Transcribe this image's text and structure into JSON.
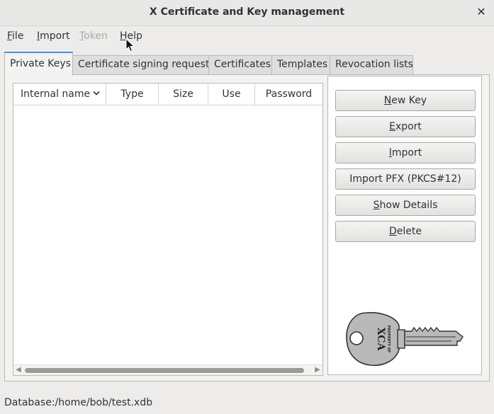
{
  "window": {
    "title": "X Certificate and Key management",
    "close_glyph": "✕"
  },
  "menu": {
    "file": {
      "ul": "F",
      "rest": "ile"
    },
    "import": {
      "ul": "I",
      "rest": "mport"
    },
    "token": {
      "ul": "T",
      "rest": "oken"
    },
    "help": {
      "ul": "H",
      "rest": "elp"
    }
  },
  "tabs": [
    {
      "label": "Private Keys",
      "active": true
    },
    {
      "label": "Certificate signing requests"
    },
    {
      "label": "Certificates"
    },
    {
      "label": "Templates"
    },
    {
      "label": "Revocation lists"
    }
  ],
  "columns": [
    "Internal name",
    "Type",
    "Size",
    "Use",
    "Password"
  ],
  "buttons": {
    "new_key": {
      "ul": "N",
      "rest": "ew Key"
    },
    "export": {
      "ul": "E",
      "rest": "xport"
    },
    "import": {
      "ul": "I",
      "rest": "mport"
    },
    "import_pfx": "Import PFX (PKCS#12)",
    "show_details": {
      "ul": "S",
      "rest": "how Details"
    },
    "delete": {
      "ul": "D",
      "rest": "elete"
    }
  },
  "logo": {
    "line1": "PROPERTY OF",
    "line2": "XCA"
  },
  "status": {
    "database": "Database:/home/bob/test.xdb"
  },
  "colors": {
    "accent": "#4a90d9",
    "key_fill": "#b9b9b9"
  }
}
